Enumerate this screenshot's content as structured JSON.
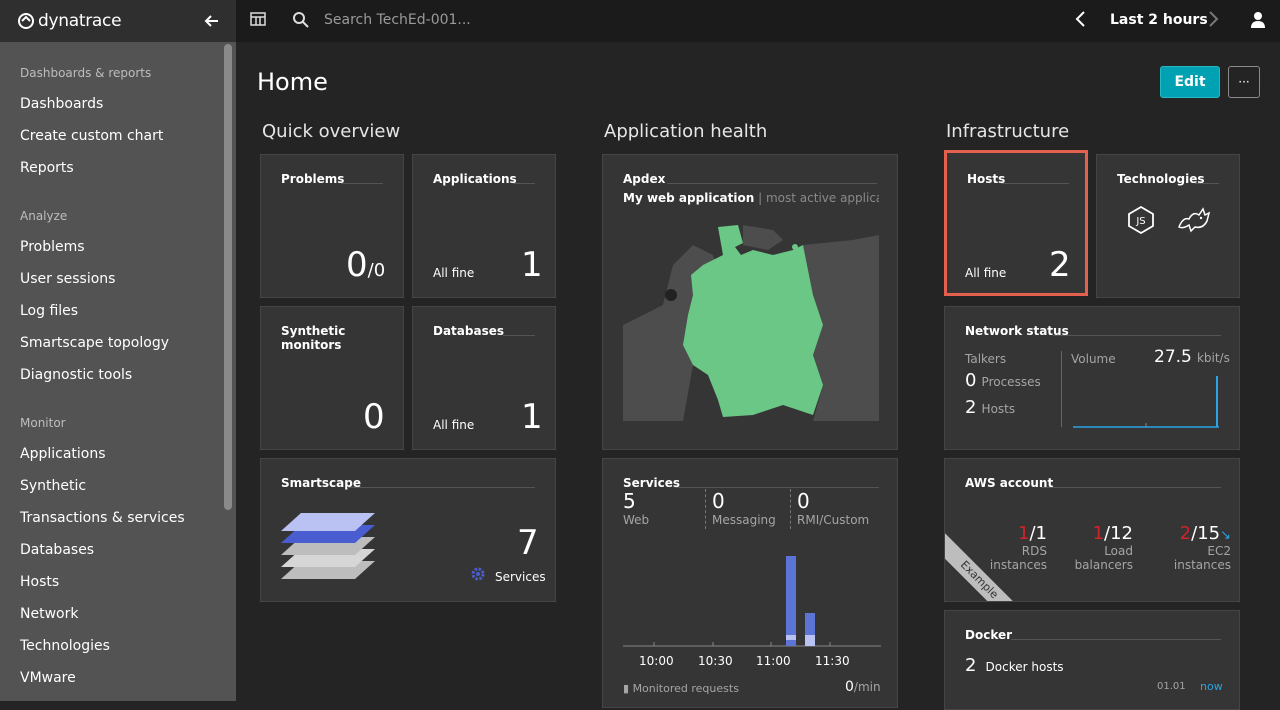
{
  "app": {
    "logo_text": "dynatrace"
  },
  "topbar": {
    "search_placeholder": "Search TechEd-001...",
    "timeframe": "Last 2 hours"
  },
  "sidebar": {
    "sections": [
      {
        "title": "Dashboards & reports",
        "items": [
          "Dashboards",
          "Create custom chart",
          "Reports"
        ]
      },
      {
        "title": "Analyze",
        "items": [
          "Problems",
          "User sessions",
          "Log files",
          "Smartscape topology",
          "Diagnostic tools"
        ]
      },
      {
        "title": "Monitor",
        "items": [
          "Applications",
          "Synthetic",
          "Transactions & services",
          "Databases",
          "Hosts",
          "Network",
          "Technologies",
          "VMware"
        ]
      }
    ]
  },
  "page": {
    "title": "Home",
    "edit_label": "Edit",
    "more_label": "···"
  },
  "columns": {
    "quick": "Quick overview",
    "apphealth": "Application health",
    "infra": "Infrastructure"
  },
  "tiles": {
    "problems": {
      "title": "Problems",
      "value": "0",
      "suffix": "/0"
    },
    "applications": {
      "title": "Applications",
      "status": "All fine",
      "value": "1"
    },
    "synthetic": {
      "title": "Synthetic monitors",
      "value": "0"
    },
    "databases": {
      "title": "Databases",
      "status": "All fine",
      "value": "1"
    },
    "smartscape": {
      "title": "Smartscape",
      "value": "7",
      "label": "Services"
    },
    "apdex": {
      "title": "Apdex",
      "app_name": "My web application",
      "app_note": "| most active applicat..."
    },
    "services": {
      "title": "Services",
      "stats": [
        {
          "value": "5",
          "label": "Web"
        },
        {
          "value": "0",
          "label": "Messaging"
        },
        {
          "value": "0",
          "label": "RMI/Custom"
        }
      ],
      "x_ticks": [
        "10:00",
        "10:30",
        "11:00",
        "11:30"
      ],
      "footer_label": "Monitored requests",
      "footer_value": "0",
      "footer_unit": "/min"
    },
    "hosts": {
      "title": "Hosts",
      "status": "All fine",
      "value": "2",
      "highlight_color": "#e2604d"
    },
    "technologies": {
      "title": "Technologies",
      "icons": [
        "nodejs-icon",
        "tomcat-icon"
      ]
    },
    "network": {
      "title": "Network status",
      "talkers_label": "Talkers",
      "processes_value": "0",
      "processes_label": "Processes",
      "hosts_value": "2",
      "hosts_label": "Hosts",
      "volume_label": "Volume",
      "volume_value": "27.5",
      "volume_unit": "kbit/s"
    },
    "aws": {
      "title": "AWS account",
      "ribbon": "Example",
      "metrics": [
        {
          "red": "1",
          "total": "/1",
          "label1": "RDS",
          "label2": "instances"
        },
        {
          "red": "1",
          "total": "/12",
          "label1": "Load",
          "label2": "balancers"
        },
        {
          "red": "2",
          "total": "/15",
          "label1": "EC2",
          "label2": "instances"
        }
      ]
    },
    "docker": {
      "title": "Docker",
      "value": "2",
      "label": "Docker hosts",
      "time_label": "01.01",
      "now_label": "now"
    }
  },
  "colors": {
    "accent": "#00a1b2",
    "map_green": "#6ac786",
    "bar_blue": "#5b74d6",
    "red": "#d0232e",
    "link_blue": "#2aa4e3"
  }
}
